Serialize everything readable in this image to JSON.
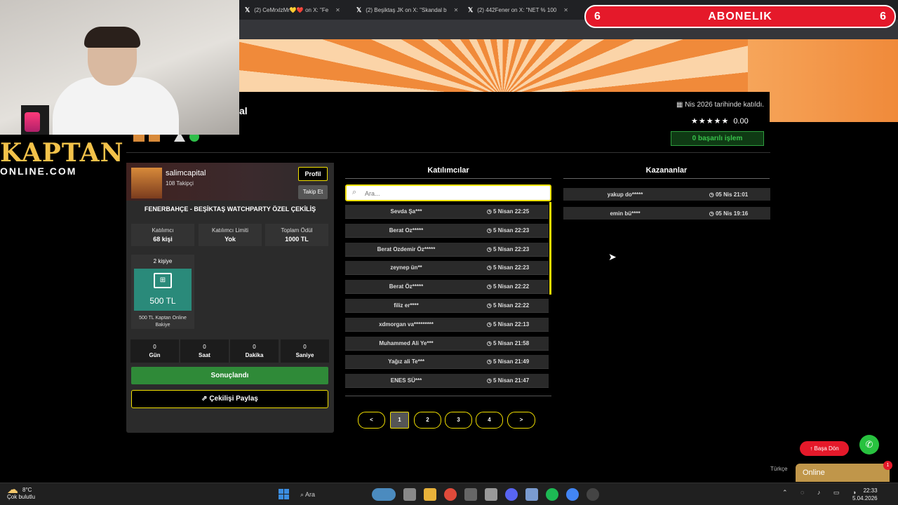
{
  "browser": {
    "tabs": [
      {
        "label": "(2) CeMrxlzMr💛❤️ on X: \"Fe"
      },
      {
        "label": "(2) Beşiktaş JK on X: \"Skandal b"
      },
      {
        "label": "(2) 442Fener on X: \"NET % 100"
      }
    ]
  },
  "overlay": {
    "abonelik_title": "ABONELIK",
    "abonelik_left": "6",
    "abonelik_right": "6"
  },
  "logo": {
    "line1": "KAPTAN",
    "line2": "ONLINE.COM"
  },
  "profile": {
    "title_fragment": "al",
    "joined": "Nis 2026 tarihinde katıldı.",
    "stars": "★★★★★",
    "rating": "0.00",
    "success_label": "0 başarılı işlem"
  },
  "card": {
    "username": "salimcapital",
    "followers": "108 Takipçi",
    "profil_label": "Profil",
    "takip_label": "Takip Et",
    "title": "FENERBAHÇE - BEŞİKTAŞ WATCHPARTY ÖZEL ÇEKİLİŞ",
    "stats": [
      {
        "label": "Katılımcı",
        "value": "68 kişi"
      },
      {
        "label": "Katılımcı Limiti",
        "value": "Yok"
      },
      {
        "label": "Toplam Ödül",
        "value": "1000 TL"
      }
    ],
    "prize": {
      "count": "2 kişiye",
      "amount": "500 TL",
      "desc": "500 TL Kaptan Online Bakiye"
    },
    "timer": [
      {
        "value": "0",
        "label": "Gün"
      },
      {
        "value": "0",
        "label": "Saat"
      },
      {
        "value": "0",
        "label": "Dakika"
      },
      {
        "value": "0",
        "label": "Saniye"
      }
    ],
    "result_label": "Sonuçlandı",
    "share_label": "Çekilişi Paylaş"
  },
  "participants": {
    "title": "Katılımcılar",
    "search_placeholder": "Ara...",
    "rows": [
      {
        "name": "Sevda Şa***",
        "time": "5 Nisan 22:25"
      },
      {
        "name": "Berat Oz*****",
        "time": "5 Nisan 22:23"
      },
      {
        "name": "Berat Ozdemir Öz*****",
        "time": "5 Nisan 22:23"
      },
      {
        "name": "zeynep ün**",
        "time": "5 Nisan 22:23"
      },
      {
        "name": "Berat Öz*****",
        "time": "5 Nisan 22:22"
      },
      {
        "name": "filiz er****",
        "time": "5 Nisan 22:22"
      },
      {
        "name": "xdmorgan va*********",
        "time": "5 Nisan 22:13"
      },
      {
        "name": "Muhammed Ali Ye***",
        "time": "5 Nisan 21:58"
      },
      {
        "name": "Yağız ali Te***",
        "time": "5 Nisan 21:49"
      },
      {
        "name": "ENES SÜ***",
        "time": "5 Nisan 21:47"
      }
    ],
    "pagination": [
      "<",
      "1",
      "2",
      "3",
      "4",
      ">"
    ]
  },
  "winners": {
    "title": "Kazananlar",
    "rows": [
      {
        "name": "yakup do*****",
        "time": "05 Nis 21:01"
      },
      {
        "name": "emin bü****",
        "time": "05 Nis 19:16"
      }
    ]
  },
  "floating": {
    "back_label": "Başa Dön",
    "online_label": "Online",
    "online_badge": "1",
    "language": "Türkçe"
  },
  "taskbar": {
    "temp": "8°C",
    "weather": "Çok bulutlu",
    "search": "Ara",
    "time": "22:33",
    "date": "5.04.2026"
  }
}
